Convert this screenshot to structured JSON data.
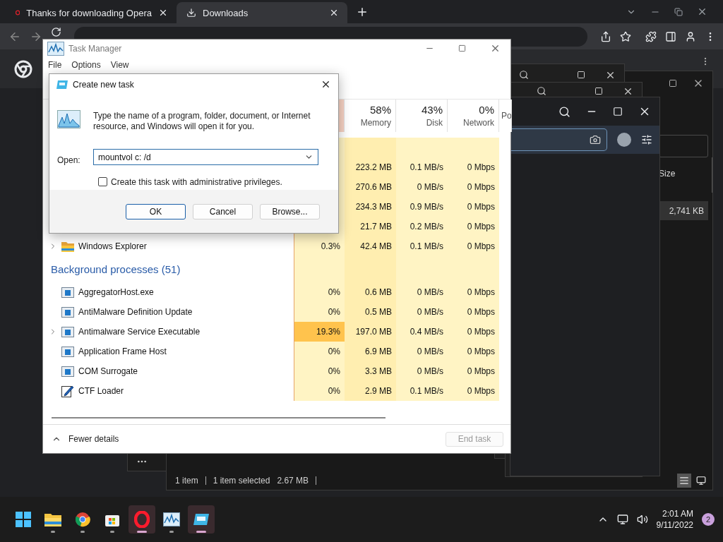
{
  "browser": {
    "tabs": [
      {
        "label": "Thanks for downloading Opera",
        "kind": "opera",
        "selected": false
      },
      {
        "label": "Downloads",
        "kind": "download",
        "selected": true
      }
    ]
  },
  "explorer": {
    "size_header": "Size",
    "selected_size": "2,741 KB",
    "status_items": [
      "1 item",
      "1 item selected",
      "2.67 MB"
    ]
  },
  "task_manager": {
    "title": "Task Manager",
    "menu": [
      "File",
      "Options",
      "View"
    ],
    "columns": [
      {
        "percent": "58%",
        "label": "Memory"
      },
      {
        "percent": "43%",
        "label": "Disk"
      },
      {
        "percent": "0%",
        "label": "Network"
      },
      {
        "label": "Po"
      }
    ],
    "rows": [
      {
        "kind": "blank"
      },
      {
        "kind": "covered",
        "memory": "223.2 MB",
        "disk": "0.1 MB/s",
        "network": "0 Mbps"
      },
      {
        "kind": "covered",
        "memory": "270.6 MB",
        "disk": "0 MB/s",
        "network": "0 Mbps"
      },
      {
        "kind": "covered",
        "memory": "234.3 MB",
        "disk": "0.9 MB/s",
        "network": "0 Mbps"
      },
      {
        "kind": "covered",
        "memory": "21.7 MB",
        "disk": "0.2 MB/s",
        "network": "0 Mbps"
      },
      {
        "kind": "folder",
        "name": "Windows Explorer",
        "expandable": true,
        "hot": false,
        "cpu": "0.3%",
        "memory": "42.4 MB",
        "disk": "0.1 MB/s",
        "network": "0 Mbps"
      },
      {
        "kind": "group",
        "label": "Background processes (51)"
      },
      {
        "kind": "service",
        "name": "AggregatorHost.exe",
        "expandable": false,
        "hot": false,
        "cpu": "0%",
        "memory": "0.6 MB",
        "disk": "0 MB/s",
        "network": "0 Mbps"
      },
      {
        "kind": "service",
        "name": "AntiMalware Definition Update",
        "expandable": false,
        "hot": false,
        "cpu": "0%",
        "memory": "0.5 MB",
        "disk": "0 MB/s",
        "network": "0 Mbps"
      },
      {
        "kind": "service",
        "name": "Antimalware Service Executable",
        "expandable": true,
        "hot": true,
        "cpu": "19.3%",
        "memory": "197.0 MB",
        "disk": "0.4 MB/s",
        "network": "0 Mbps"
      },
      {
        "kind": "service",
        "name": "Application Frame Host",
        "expandable": false,
        "hot": false,
        "cpu": "0%",
        "memory": "6.9 MB",
        "disk": "0 MB/s",
        "network": "0 Mbps"
      },
      {
        "kind": "service",
        "name": "COM Surrogate",
        "expandable": false,
        "hot": false,
        "cpu": "0%",
        "memory": "3.3 MB",
        "disk": "0 MB/s",
        "network": "0 Mbps"
      },
      {
        "kind": "pen",
        "name": "CTF Loader",
        "expandable": false,
        "hot": false,
        "cpu": "0%",
        "memory": "2.9 MB",
        "disk": "0.1 MB/s",
        "network": "0 Mbps"
      }
    ],
    "fewer_details": "Fewer details",
    "end_task": {
      "label": "End task",
      "disabled": true
    }
  },
  "dialog": {
    "title": "Create new task",
    "message": "Type the name of a program, folder, document, or Internet resource, and Windows will open it for you.",
    "open_label": "Open:",
    "value": "mountvol c: /d",
    "admin_checkbox": {
      "label": "Create this task with administrative privileges.",
      "checked": false
    },
    "buttons": [
      {
        "label": "OK",
        "default": true
      },
      {
        "label": "Cancel",
        "default": false
      },
      {
        "label": "Browse...",
        "default": false
      }
    ]
  },
  "taskbar": {
    "apps": [
      {
        "kind": "start",
        "active": false
      },
      {
        "kind": "explorer",
        "active": false
      },
      {
        "kind": "chrome",
        "active": false
      },
      {
        "kind": "store",
        "active": false
      },
      {
        "kind": "opera",
        "active": true
      },
      {
        "kind": "taskmgr",
        "active": false
      },
      {
        "kind": "run",
        "active": true
      }
    ],
    "time": "2:01 AM",
    "date": "9/11/2022",
    "notifications": "2"
  }
}
